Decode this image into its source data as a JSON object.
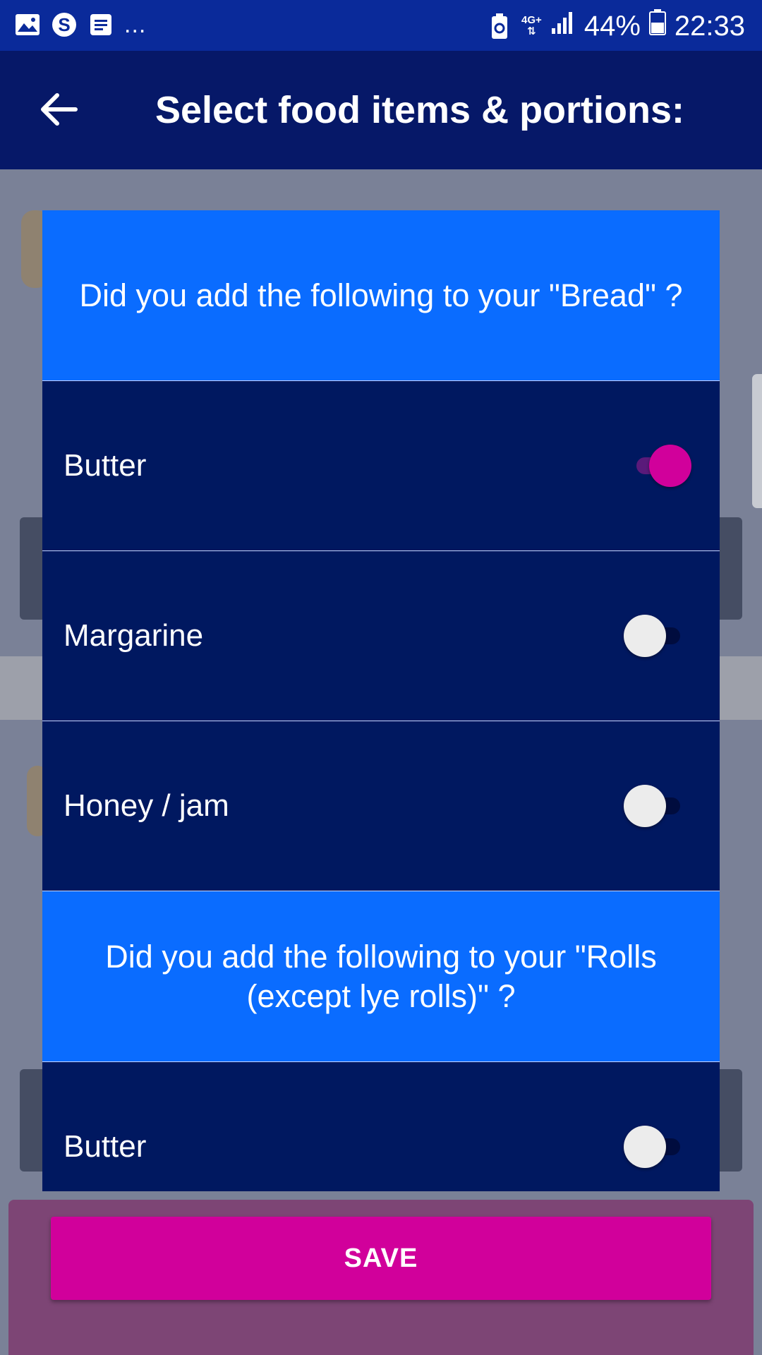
{
  "status_bar": {
    "left_icons": [
      "gallery-icon",
      "skype-icon",
      "notes-icon"
    ],
    "overflow": "...",
    "network": "4G+",
    "battery": "44%",
    "time": "22:33"
  },
  "app_bar": {
    "back_icon": "back-arrow-icon",
    "title": "Select food items & portions:"
  },
  "dialog": {
    "sections": [
      {
        "question": "Did you add the following to your \"Bread\" ?",
        "options": [
          {
            "label": "Butter",
            "checked": true
          },
          {
            "label": "Margarine",
            "checked": false
          },
          {
            "label": "Honey / jam",
            "checked": false
          }
        ]
      },
      {
        "question": "Did you add the following to your \"Rolls (except lye rolls)\" ?",
        "options": [
          {
            "label": "Butter",
            "checked": false
          }
        ]
      }
    ]
  },
  "save": {
    "label": "SAVE"
  },
  "colors": {
    "status_bar": "#0a2a9a",
    "app_bar": "#061868",
    "dialog_header": "#0a6cff",
    "dialog_body": "#001860",
    "accent": "#d1009b",
    "save_area": "#7d4575"
  }
}
